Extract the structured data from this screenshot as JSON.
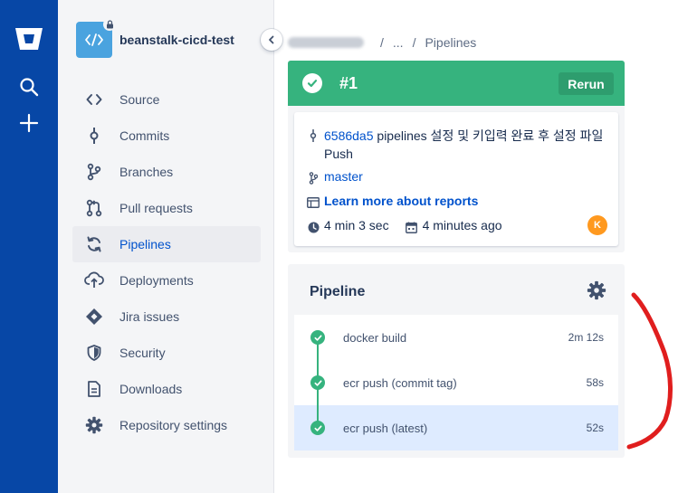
{
  "repo": {
    "name": "beanstalk-cicd-test"
  },
  "sidebar": {
    "items": [
      {
        "label": "Source",
        "icon": "source-code-icon"
      },
      {
        "label": "Commits",
        "icon": "commit-icon"
      },
      {
        "label": "Branches",
        "icon": "branch-icon"
      },
      {
        "label": "Pull requests",
        "icon": "pull-request-icon"
      },
      {
        "label": "Pipelines",
        "icon": "pipelines-icon",
        "active": true
      },
      {
        "label": "Deployments",
        "icon": "cloud-upload-icon"
      },
      {
        "label": "Jira issues",
        "icon": "jira-icon"
      },
      {
        "label": "Security",
        "icon": "shield-icon"
      },
      {
        "label": "Downloads",
        "icon": "document-icon"
      },
      {
        "label": "Repository settings",
        "icon": "gear-icon"
      }
    ]
  },
  "breadcrumb": {
    "ellipsis": "...",
    "separator": "/",
    "current": "Pipelines"
  },
  "result": {
    "build_number": "#1",
    "rerun_label": "Rerun",
    "commit_hash": "6586da5",
    "commit_message": "pipelines 설정 및 키입력 완료 후 설정 파일 Push",
    "branch": "master",
    "reports_link": "Learn more about reports",
    "duration": "4 min 3 sec",
    "time_ago": "4 minutes ago",
    "author_initial": "K"
  },
  "pipeline": {
    "title": "Pipeline",
    "steps": [
      {
        "name": "docker build",
        "duration": "2m 12s"
      },
      {
        "name": "ecr push (commit tag)",
        "duration": "58s"
      },
      {
        "name": "ecr push (latest)",
        "duration": "52s",
        "selected": true
      }
    ]
  },
  "colors": {
    "global_nav": "#0747a6",
    "success": "#36b37e",
    "link": "#0052cc",
    "selected_row": "#deebff",
    "annotation": "#e01e1e"
  }
}
